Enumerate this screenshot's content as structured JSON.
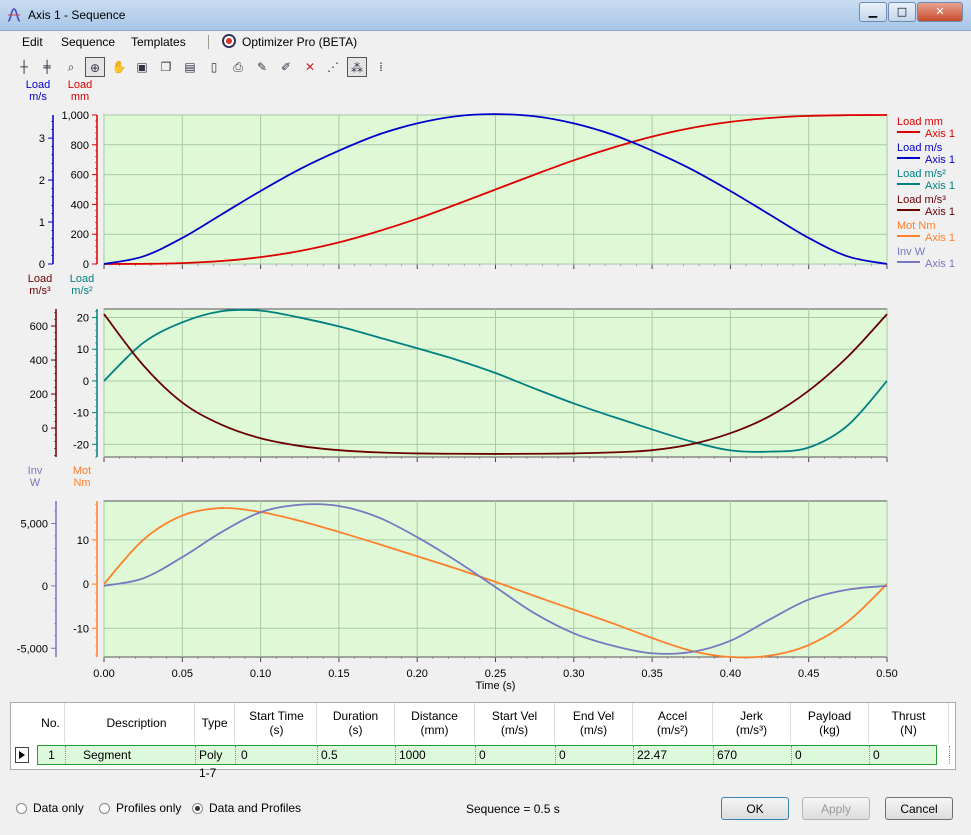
{
  "window": {
    "title": "Axis 1 - Sequence",
    "min": "▁",
    "max": "□",
    "close": "✕"
  },
  "menu": {
    "edit": "Edit",
    "sequence": "Sequence",
    "templates": "Templates",
    "optimizer": "Optimizer Pro (BETA)"
  },
  "toolbar": {
    "icons": [
      "crosshair-icon",
      "crosshair-multi-icon",
      "zoom-icon",
      "zoom-region-icon",
      "pan-icon",
      "save-icon",
      "copy-icon",
      "copy-data-icon",
      "export-icon",
      "print-icon",
      "pen-icon",
      "pen-alt-icon",
      "series-icon",
      "points-icon",
      "markers-icon",
      "cursor-icon"
    ]
  },
  "colors": {
    "plot_bg": "#dff9d6",
    "grid": "#a9c9a9",
    "load_mm": "#dd0000",
    "load_ms": "#0000cc",
    "load_ms2": "#008080",
    "load_ms3": "#6b0000",
    "mot_nm": "#ff7f2a",
    "inv_w": "#7878c0"
  },
  "legend": [
    {
      "label": "Load mm",
      "series": "Axis 1",
      "color": "#dd0000"
    },
    {
      "label": "Load m/s",
      "series": "Axis 1",
      "color": "#0000cc"
    },
    {
      "label": "Load m/s²",
      "series": "Axis 1",
      "color": "#008080"
    },
    {
      "label": "Load m/s³",
      "series": "Axis 1",
      "color": "#6b0000"
    },
    {
      "label": "Mot Nm",
      "series": "Axis 1",
      "color": "#ff7f2a"
    },
    {
      "label": "Inv W",
      "series": "Axis 1",
      "color": "#7878c0"
    }
  ],
  "chart_data": [
    {
      "type": "line",
      "x_ticks": [
        0.0,
        0.05,
        0.1,
        0.15,
        0.2,
        0.25,
        0.3,
        0.35,
        0.4,
        0.45,
        0.5
      ],
      "xlim": [
        0,
        0.5
      ],
      "axes": [
        {
          "title_line1": "Load",
          "title_line2": "m/s",
          "ylim": [
            0,
            3.55
          ],
          "ticks": [
            0,
            1,
            2,
            3
          ],
          "tick_labels": [
            "0",
            "1",
            "2",
            "3"
          ]
        },
        {
          "title_line1": "Load",
          "title_line2": "mm",
          "ylim": [
            0,
            1000
          ],
          "ticks": [
            0,
            200,
            400,
            600,
            800,
            1000
          ],
          "tick_labels": [
            "0",
            "200",
            "400",
            "600",
            "800",
            "1,000"
          ]
        }
      ],
      "series": [
        {
          "name": "Load mm",
          "axis": 1,
          "x": [
            0,
            0.025,
            0.05,
            0.075,
            0.1,
            0.125,
            0.15,
            0.175,
            0.2,
            0.225,
            0.25,
            0.275,
            0.3,
            0.325,
            0.35,
            0.375,
            0.4,
            0.425,
            0.45,
            0.475,
            0.5
          ],
          "y": [
            0,
            1,
            6,
            20,
            46,
            87,
            145,
            219,
            304,
            400,
            500,
            600,
            696,
            781,
            855,
            913,
            954,
            980,
            994,
            999,
            1000
          ]
        },
        {
          "name": "Load m/s",
          "axis": 0,
          "x": [
            0,
            0.025,
            0.05,
            0.075,
            0.1,
            0.125,
            0.15,
            0.175,
            0.2,
            0.225,
            0.25,
            0.275,
            0.3,
            0.325,
            0.35,
            0.375,
            0.4,
            0.425,
            0.45,
            0.475,
            0.5
          ],
          "y": [
            0,
            0.18,
            0.62,
            1.18,
            1.74,
            2.26,
            2.7,
            3.08,
            3.35,
            3.52,
            3.57,
            3.52,
            3.35,
            3.08,
            2.7,
            2.26,
            1.74,
            1.18,
            0.62,
            0.18,
            0
          ]
        }
      ]
    },
    {
      "type": "line",
      "x_ticks": [
        0.0,
        0.05,
        0.1,
        0.15,
        0.2,
        0.25,
        0.3,
        0.35,
        0.4,
        0.45,
        0.5
      ],
      "xlim": [
        0,
        0.5
      ],
      "axes": [
        {
          "title_line1": "Load",
          "title_line2": "m/s³",
          "ylim": [
            -170,
            700
          ],
          "ticks": [
            0,
            200,
            400,
            600
          ],
          "tick_labels": [
            "0",
            "200",
            "400",
            "600"
          ]
        },
        {
          "title_line1": "Load",
          "title_line2": "m/s²",
          "ylim": [
            -24,
            22.7
          ],
          "ticks": [
            -20,
            -10,
            0,
            10,
            20
          ],
          "tick_labels": [
            "-20",
            "-10",
            "0",
            "10",
            "20"
          ]
        }
      ],
      "series": [
        {
          "name": "Load m/s²",
          "axis": 1,
          "x": [
            0,
            0.025,
            0.05,
            0.075,
            0.1,
            0.125,
            0.15,
            0.175,
            0.2,
            0.225,
            0.25,
            0.275,
            0.3,
            0.325,
            0.35,
            0.375,
            0.4,
            0.425,
            0.45,
            0.475,
            0.5
          ],
          "y": [
            0,
            12,
            18.5,
            22,
            22.2,
            20,
            17.2,
            13.8,
            10.3,
            6.7,
            2.5,
            -2.4,
            -7.1,
            -11.3,
            -15.3,
            -19.1,
            -21.9,
            -22.3,
            -21,
            -14,
            0
          ]
        },
        {
          "name": "Load m/s³",
          "axis": 0,
          "x": [
            0,
            0.025,
            0.05,
            0.075,
            0.1,
            0.125,
            0.15,
            0.175,
            0.2,
            0.225,
            0.25,
            0.275,
            0.3,
            0.325,
            0.35,
            0.375,
            0.4,
            0.425,
            0.45,
            0.475,
            0.5
          ],
          "y": [
            670,
            370,
            150,
            20,
            -60,
            -105,
            -130,
            -143,
            -149,
            -151,
            -152,
            -151,
            -149,
            -143,
            -130,
            -95,
            -30,
            70,
            220,
            420,
            670
          ]
        }
      ]
    },
    {
      "type": "line",
      "x_ticks": [
        0.0,
        0.05,
        0.1,
        0.15,
        0.2,
        0.25,
        0.3,
        0.35,
        0.4,
        0.45,
        0.5
      ],
      "x_tick_labels": [
        "0.00",
        "0.05",
        "0.10",
        "0.15",
        "0.20",
        "0.25",
        "0.30",
        "0.35",
        "0.40",
        "0.45",
        "0.50"
      ],
      "xlim": [
        0,
        0.5
      ],
      "xlabel": "Time  (s)",
      "axes": [
        {
          "title_line1": "Inv",
          "title_line2": "W",
          "ylim": [
            -5700,
            6800
          ],
          "ticks": [
            -5000,
            0,
            5000
          ],
          "tick_labels": [
            "-5,000",
            "0",
            "5,000"
          ]
        },
        {
          "title_line1": "Mot",
          "title_line2": "Nm",
          "ylim": [
            -16.5,
            18.8
          ],
          "ticks": [
            -10,
            0,
            10
          ],
          "tick_labels": [
            "-10",
            "0",
            "10"
          ]
        }
      ],
      "series": [
        {
          "name": "Mot Nm",
          "axis": 1,
          "x": [
            0,
            0.025,
            0.05,
            0.075,
            0.1,
            0.125,
            0.15,
            0.175,
            0.2,
            0.225,
            0.25,
            0.275,
            0.3,
            0.325,
            0.35,
            0.375,
            0.4,
            0.425,
            0.45,
            0.475,
            0.5
          ],
          "y": [
            0,
            10,
            15.5,
            17.2,
            16.3,
            14.3,
            11.8,
            9.1,
            6.3,
            3.5,
            0.5,
            -2.7,
            -5.8,
            -8.9,
            -12.2,
            -15.1,
            -16.5,
            -16.2,
            -13.8,
            -8.5,
            0
          ]
        },
        {
          "name": "Inv W",
          "axis": 0,
          "x": [
            0,
            0.025,
            0.05,
            0.075,
            0.1,
            0.125,
            0.15,
            0.175,
            0.2,
            0.225,
            0.25,
            0.275,
            0.3,
            0.325,
            0.35,
            0.375,
            0.4,
            0.425,
            0.45,
            0.475,
            0.5
          ],
          "y": [
            0,
            600,
            2300,
            4300,
            5900,
            6500,
            6400,
            5500,
            3900,
            2000,
            -100,
            -2200,
            -3800,
            -4800,
            -5400,
            -5300,
            -4400,
            -2700,
            -1100,
            -300,
            0
          ]
        }
      ]
    }
  ],
  "table": {
    "headers": [
      {
        "l1": "No.",
        "l2": ""
      },
      {
        "l1": "Description",
        "l2": ""
      },
      {
        "l1": "Type",
        "l2": ""
      },
      {
        "l1": "Start Time",
        "l2": "(s)"
      },
      {
        "l1": "Duration",
        "l2": "(s)"
      },
      {
        "l1": "Distance",
        "l2": "(mm)"
      },
      {
        "l1": "Start Vel",
        "l2": "(m/s)"
      },
      {
        "l1": "End Vel",
        "l2": "(m/s)"
      },
      {
        "l1": "Accel",
        "l2": "(m/s²)"
      },
      {
        "l1": "Jerk",
        "l2": "(m/s³)"
      },
      {
        "l1": "Payload",
        "l2": "(kg)"
      },
      {
        "l1": "Thrust",
        "l2": "(N)"
      }
    ],
    "row": [
      "1",
      "Segment",
      "Poly 1-7",
      "0",
      "0.5",
      "1000",
      "0",
      "0",
      "22.47",
      "670",
      "0",
      "0"
    ]
  },
  "footer": {
    "radio_data_only": "Data only",
    "radio_profiles_only": "Profiles only",
    "radio_both": "Data and Profiles",
    "status": "Sequence = 0.5 s",
    "ok": "OK",
    "apply": "Apply",
    "cancel": "Cancel"
  }
}
